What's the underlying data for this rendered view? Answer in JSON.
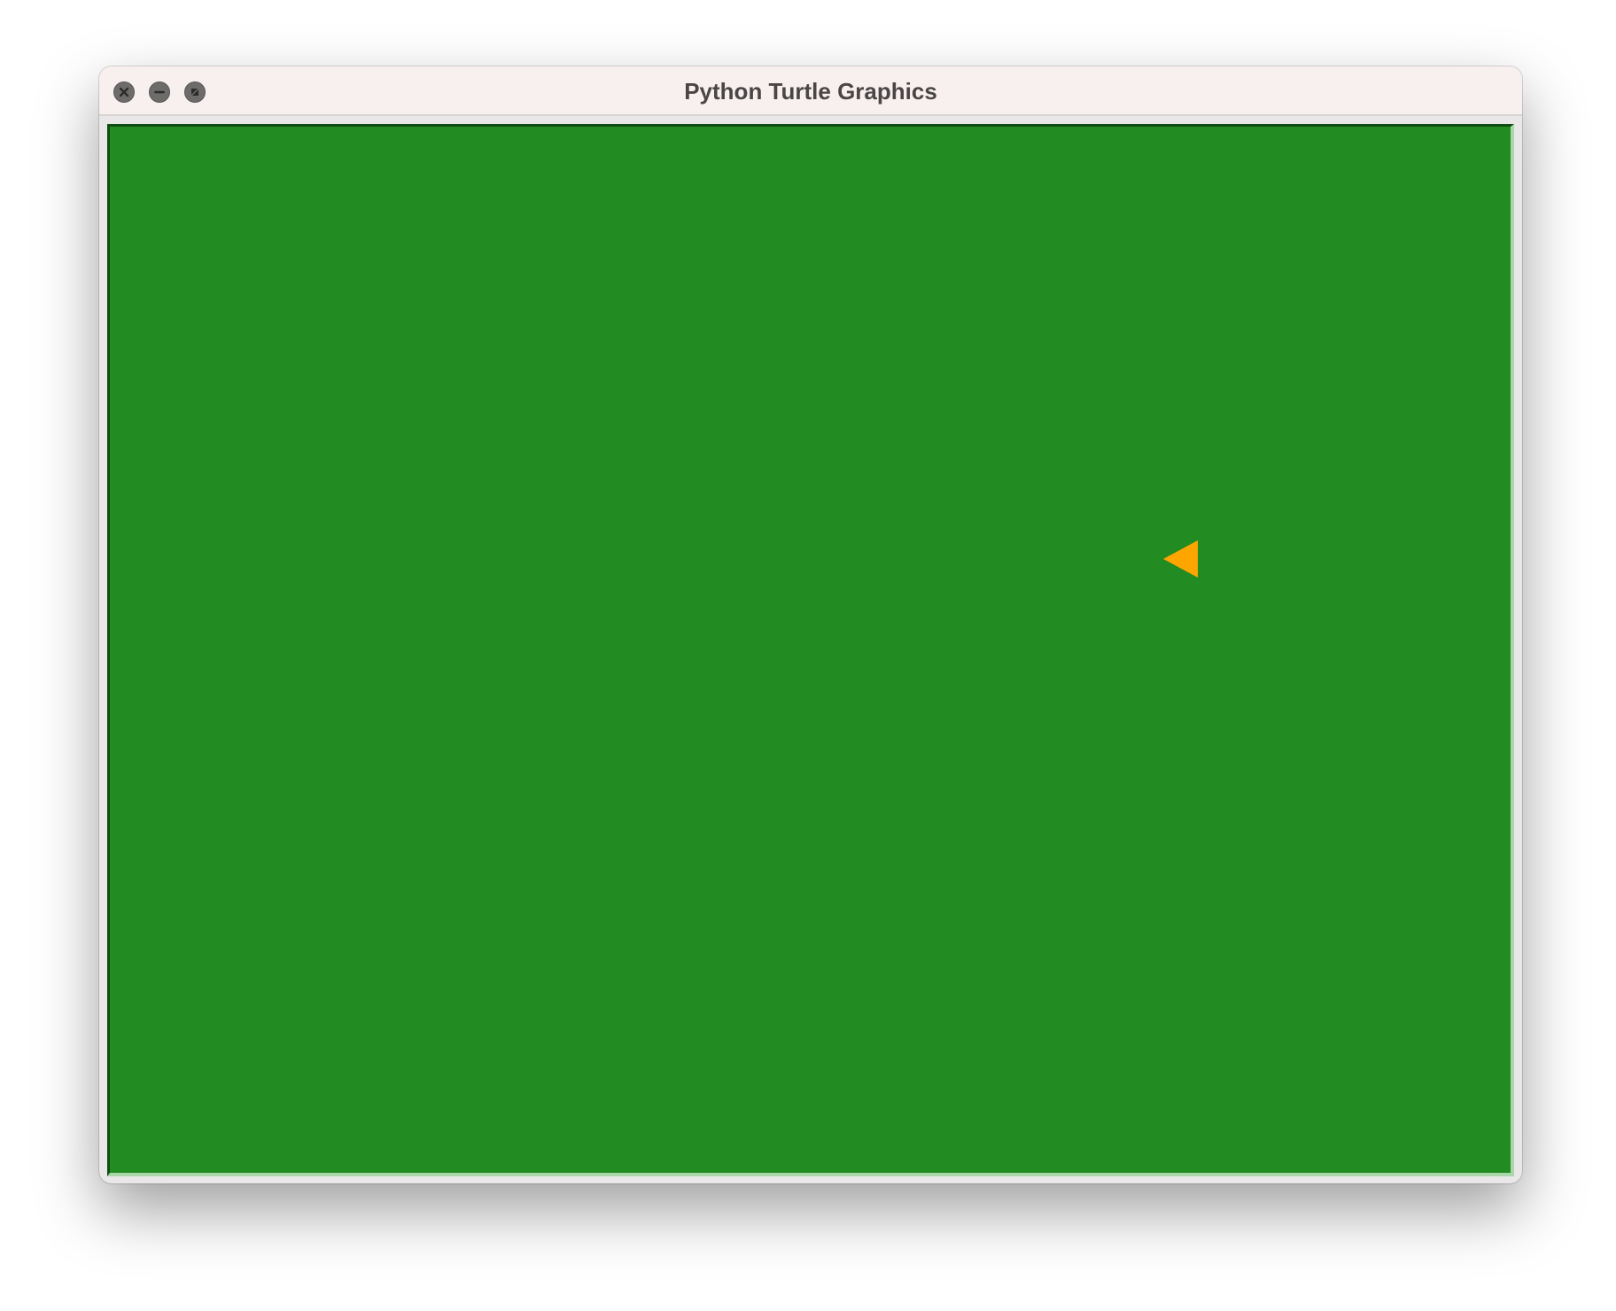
{
  "window": {
    "title": "Python Turtle Graphics"
  },
  "controls": {
    "close": "close-icon",
    "minimize": "minimize-icon",
    "maximize": "maximize-icon"
  },
  "canvas": {
    "background_color": "#228B22"
  },
  "turtle": {
    "shape": "arrow",
    "color": "#FFA500",
    "heading": "left"
  }
}
